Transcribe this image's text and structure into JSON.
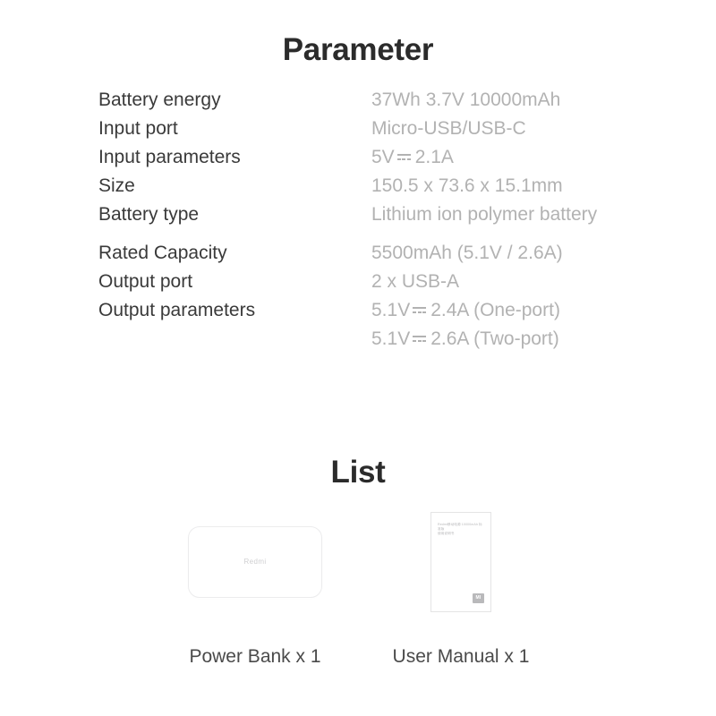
{
  "parameter_section": {
    "title": "Parameter",
    "rows": [
      {
        "label": "Battery energy",
        "value": "37Wh 3.7V 10000mAh"
      },
      {
        "label": "Input port",
        "value": "Micro-USB/USB-C"
      },
      {
        "label": "Input parameters",
        "value_prefix": "5V",
        "dc_symbol": "dc-power-icon",
        "value_suffix": "2.1A"
      },
      {
        "label": "Size",
        "value": "150.5 x 73.6 x 15.1mm"
      },
      {
        "label": "Battery type",
        "value": "Lithium ion polymer battery"
      },
      {
        "label": "Rated Capacity",
        "value": "5500mAh (5.1V / 2.6A)"
      },
      {
        "label": "Output port",
        "value": "2 x USB-A"
      },
      {
        "label": "Output parameters",
        "line1_prefix": "5.1V",
        "line1_suffix": "2.4A (One-port)",
        "line2_prefix": "5.1V",
        "line2_suffix": "2.6A (Two-port)"
      }
    ]
  },
  "list_section": {
    "title": "List",
    "items": [
      {
        "caption": "Power Bank x 1",
        "art": "power-bank-illustration",
        "brand": "Redmi"
      },
      {
        "caption": "User Manual x 1",
        "art": "user-manual-illustration",
        "cover_line1": "Redmi移动电源 10000mAh 标准版",
        "cover_line2": "使用说明书",
        "logo_text": "MI"
      }
    ]
  },
  "colors": {
    "heading": "#2b2b2b",
    "label": "#3a3a3a",
    "value": "#b2b2b2",
    "caption": "#4a4a4a",
    "outline": "#ececed",
    "background": "#ffffff"
  }
}
